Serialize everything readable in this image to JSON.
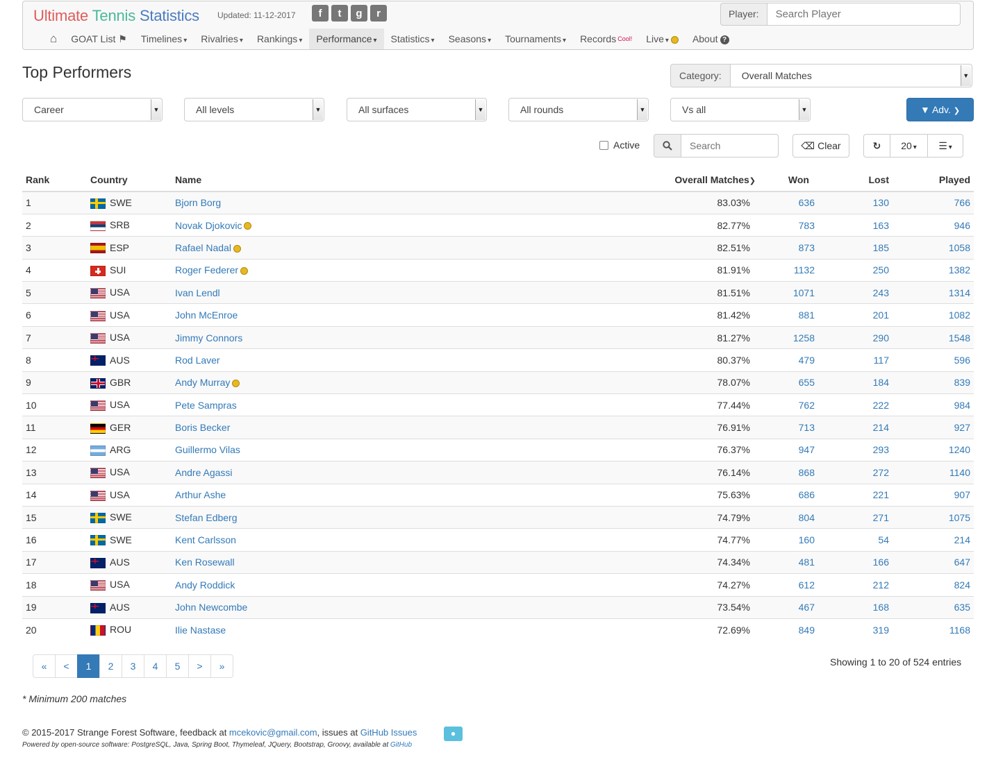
{
  "header": {
    "brand": {
      "word1": "Ultimate",
      "word2": "Tennis",
      "word3": "Statistics"
    },
    "updated": "Updated: 11-12-2017",
    "social": [
      {
        "icon": "facebook-icon",
        "glyph": "f"
      },
      {
        "icon": "twitter-icon",
        "glyph": "t"
      },
      {
        "icon": "github-icon",
        "glyph": "g"
      },
      {
        "icon": "rss-icon",
        "glyph": "r"
      }
    ],
    "player_label": "Player:",
    "player_placeholder": "Search Player",
    "menu": {
      "home": "⌂",
      "goat": "GOAT List",
      "timelines": "Timelines",
      "rivalries": "Rivalries",
      "rankings": "Rankings",
      "performance": "Performance",
      "statistics": "Statistics",
      "seasons": "Seasons",
      "tournaments": "Tournaments",
      "records": "Records",
      "records_badge": "Cool!",
      "live": "Live",
      "about": "About"
    }
  },
  "page": {
    "title": "Top Performers",
    "category_label": "Category:",
    "category_value": "Overall Matches"
  },
  "filters": {
    "period": "Career",
    "level": "All levels",
    "surface": "All surfaces",
    "round": "All rounds",
    "opponent": "Vs all",
    "adv_label": "Adv."
  },
  "tools": {
    "active_label": "Active",
    "search_placeholder": "Search",
    "clear_label": "Clear",
    "page_size": "20"
  },
  "table": {
    "columns": {
      "rank": "Rank",
      "country": "Country",
      "name": "Name",
      "metric": "Overall Matches",
      "won": "Won",
      "lost": "Lost",
      "played": "Played"
    },
    "rows": [
      {
        "rank": "1",
        "country": "SWE",
        "name": "Bjorn Borg",
        "active": false,
        "pct": "83.03%",
        "won": "636",
        "lost": "130",
        "played": "766"
      },
      {
        "rank": "2",
        "country": "SRB",
        "name": "Novak Djokovic",
        "active": true,
        "pct": "82.77%",
        "won": "783",
        "lost": "163",
        "played": "946"
      },
      {
        "rank": "3",
        "country": "ESP",
        "name": "Rafael Nadal",
        "active": true,
        "pct": "82.51%",
        "won": "873",
        "lost": "185",
        "played": "1058"
      },
      {
        "rank": "4",
        "country": "SUI",
        "name": "Roger Federer",
        "active": true,
        "pct": "81.91%",
        "won": "1132",
        "lost": "250",
        "played": "1382"
      },
      {
        "rank": "5",
        "country": "USA",
        "name": "Ivan Lendl",
        "active": false,
        "pct": "81.51%",
        "won": "1071",
        "lost": "243",
        "played": "1314"
      },
      {
        "rank": "6",
        "country": "USA",
        "name": "John McEnroe",
        "active": false,
        "pct": "81.42%",
        "won": "881",
        "lost": "201",
        "played": "1082"
      },
      {
        "rank": "7",
        "country": "USA",
        "name": "Jimmy Connors",
        "active": false,
        "pct": "81.27%",
        "won": "1258",
        "lost": "290",
        "played": "1548"
      },
      {
        "rank": "8",
        "country": "AUS",
        "name": "Rod Laver",
        "active": false,
        "pct": "80.37%",
        "won": "479",
        "lost": "117",
        "played": "596"
      },
      {
        "rank": "9",
        "country": "GBR",
        "name": "Andy Murray",
        "active": true,
        "pct": "78.07%",
        "won": "655",
        "lost": "184",
        "played": "839"
      },
      {
        "rank": "10",
        "country": "USA",
        "name": "Pete Sampras",
        "active": false,
        "pct": "77.44%",
        "won": "762",
        "lost": "222",
        "played": "984"
      },
      {
        "rank": "11",
        "country": "GER",
        "name": "Boris Becker",
        "active": false,
        "pct": "76.91%",
        "won": "713",
        "lost": "214",
        "played": "927"
      },
      {
        "rank": "12",
        "country": "ARG",
        "name": "Guillermo Vilas",
        "active": false,
        "pct": "76.37%",
        "won": "947",
        "lost": "293",
        "played": "1240"
      },
      {
        "rank": "13",
        "country": "USA",
        "name": "Andre Agassi",
        "active": false,
        "pct": "76.14%",
        "won": "868",
        "lost": "272",
        "played": "1140"
      },
      {
        "rank": "14",
        "country": "USA",
        "name": "Arthur Ashe",
        "active": false,
        "pct": "75.63%",
        "won": "686",
        "lost": "221",
        "played": "907"
      },
      {
        "rank": "15",
        "country": "SWE",
        "name": "Stefan Edberg",
        "active": false,
        "pct": "74.79%",
        "won": "804",
        "lost": "271",
        "played": "1075"
      },
      {
        "rank": "16",
        "country": "SWE",
        "name": "Kent Carlsson",
        "active": false,
        "pct": "74.77%",
        "won": "160",
        "lost": "54",
        "played": "214"
      },
      {
        "rank": "17",
        "country": "AUS",
        "name": "Ken Rosewall",
        "active": false,
        "pct": "74.34%",
        "won": "481",
        "lost": "166",
        "played": "647"
      },
      {
        "rank": "18",
        "country": "USA",
        "name": "Andy Roddick",
        "active": false,
        "pct": "74.27%",
        "won": "612",
        "lost": "212",
        "played": "824"
      },
      {
        "rank": "19",
        "country": "AUS",
        "name": "John Newcombe",
        "active": false,
        "pct": "73.54%",
        "won": "467",
        "lost": "168",
        "played": "635"
      },
      {
        "rank": "20",
        "country": "ROU",
        "name": "Ilie Nastase",
        "active": false,
        "pct": "72.69%",
        "won": "849",
        "lost": "319",
        "played": "1168"
      }
    ]
  },
  "pagination": {
    "first": "«",
    "prev": "<",
    "pages": [
      "1",
      "2",
      "3",
      "4",
      "5"
    ],
    "current": "1",
    "next": ">",
    "last": "»",
    "showing": "Showing 1 to 20 of 524 entries"
  },
  "note": "* Minimum 200 matches",
  "footer": {
    "copyright": "© 2015-2017 Strange Forest Software, feedback at ",
    "email": "mcekovic@gmail.com",
    "issues_prefix": ", issues at ",
    "issues_link": "GitHub Issues",
    "powered": "Powered by open-source software: PostgreSQL, Java, Spring Boot, Thymeleaf, JQuery, Bootstrap, Groovy, available at ",
    "powered_link": "GitHub"
  },
  "colors": {
    "link": "#337ab7",
    "primary": "#337ab7",
    "brand_red": "#e05c5c",
    "brand_green": "#4bb89a",
    "brand_blue": "#4b7bc0",
    "active_ball": "#e8b820"
  }
}
